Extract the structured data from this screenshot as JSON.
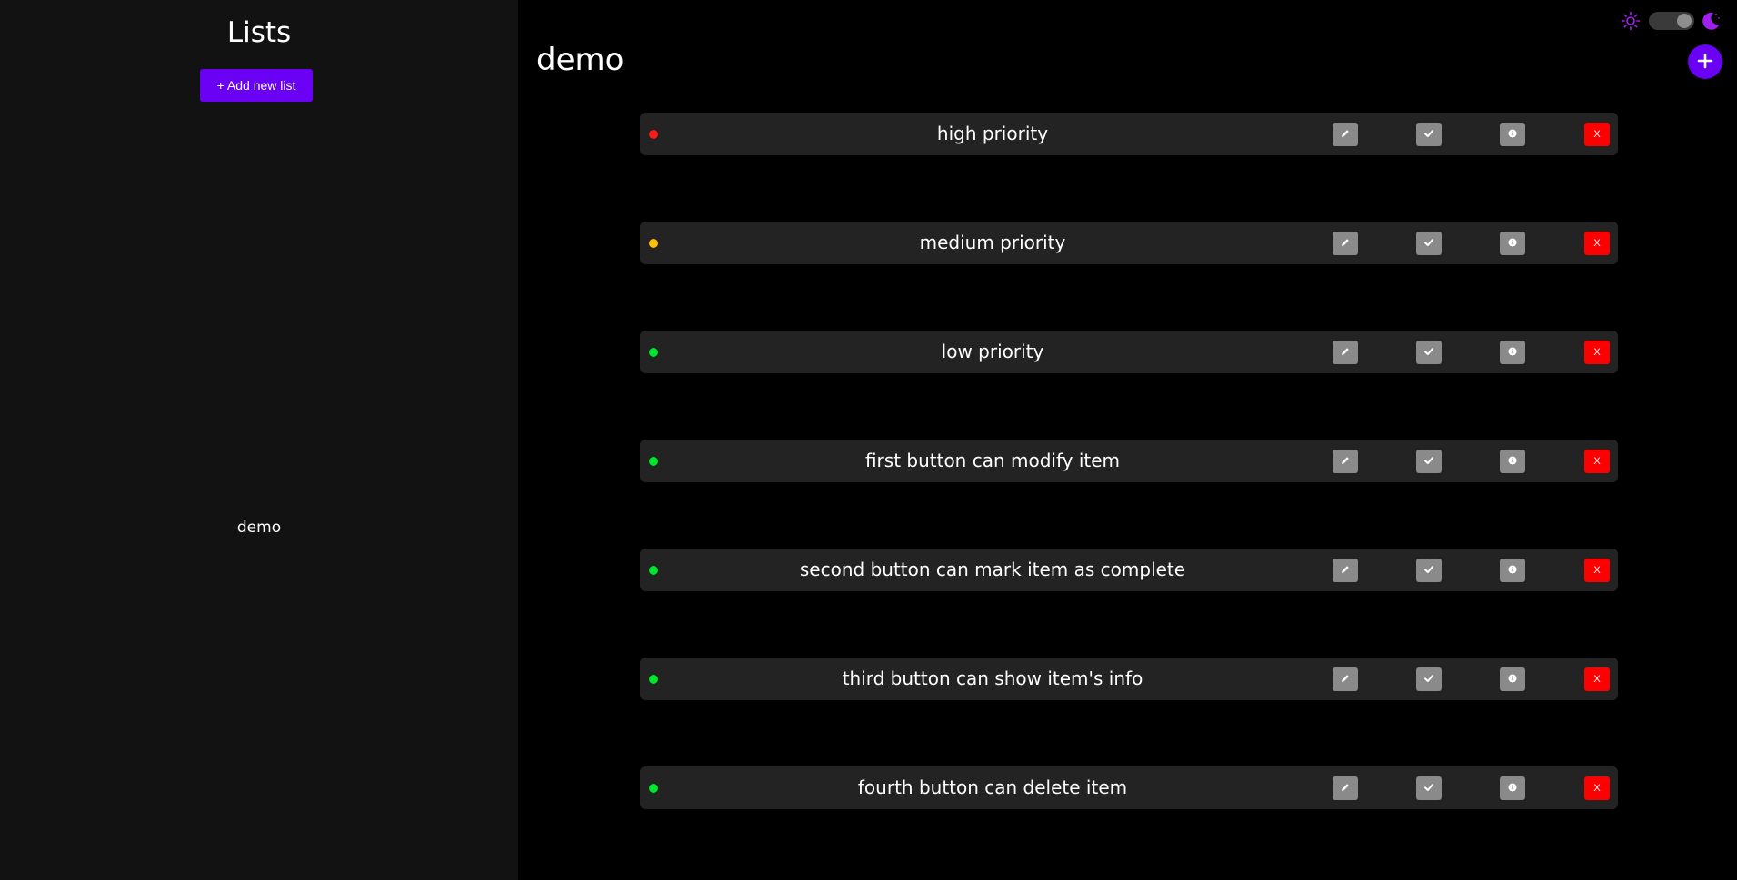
{
  "sidebar": {
    "title": "Lists",
    "add_button_label": "+ Add new list",
    "lists": [
      {
        "label": "demo"
      }
    ]
  },
  "main": {
    "title": "demo",
    "fab_icon": "plus-icon",
    "theme": {
      "sun_icon": "sun-icon",
      "moon_icon": "moon-icon",
      "mode": "dark",
      "accent_color": "#a020f0"
    },
    "tasks": [
      {
        "label": "high priority",
        "priority": "high",
        "color": "#ff1a1a"
      },
      {
        "label": "medium priority",
        "priority": "medium",
        "color": "#ffc107"
      },
      {
        "label": "low priority",
        "priority": "low",
        "color": "#00e62e"
      },
      {
        "label": "first button can modify item",
        "priority": "low",
        "color": "#00e62e"
      },
      {
        "label": "second button can mark item as complete",
        "priority": "low",
        "color": "#00e62e"
      },
      {
        "label": "third button can show item's info",
        "priority": "low",
        "color": "#00e62e"
      },
      {
        "label": "fourth button can delete item",
        "priority": "low",
        "color": "#00e62e"
      }
    ],
    "task_actions": {
      "edit_icon": "pencil-icon",
      "complete_icon": "check-icon",
      "info_icon": "info-icon",
      "delete_label": "X"
    }
  },
  "colors": {
    "accent": "#6a00f4",
    "sidebar_bg": "#121212",
    "main_bg": "#000000",
    "row_bg": "#232323",
    "action_grey": "#8a8a8a",
    "delete_red": "#ff0000"
  }
}
